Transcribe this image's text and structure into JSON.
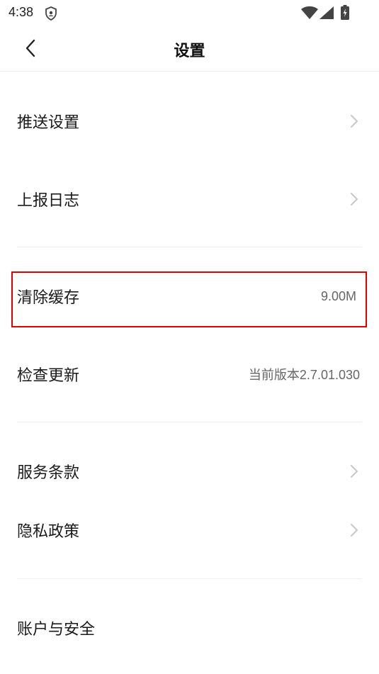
{
  "status_bar": {
    "time": "4:38"
  },
  "header": {
    "title": "设置"
  },
  "settings": {
    "push": {
      "label": "推送设置"
    },
    "report_log": {
      "label": "上报日志"
    },
    "clear_cache": {
      "label": "清除缓存",
      "value": "9.00M"
    },
    "check_update": {
      "label": "检查更新",
      "value": "当前版本2.7.01.030"
    },
    "terms": {
      "label": "服务条款"
    },
    "privacy": {
      "label": "隐私政策"
    },
    "account_security": {
      "label": "账户与安全"
    }
  },
  "icons": {
    "back": "chevron-left-icon",
    "row_arrow": "chevron-right-icon"
  },
  "colors": {
    "highlight": "#e00000",
    "divider": "#efefef",
    "chevron": "#c8c8c8"
  }
}
